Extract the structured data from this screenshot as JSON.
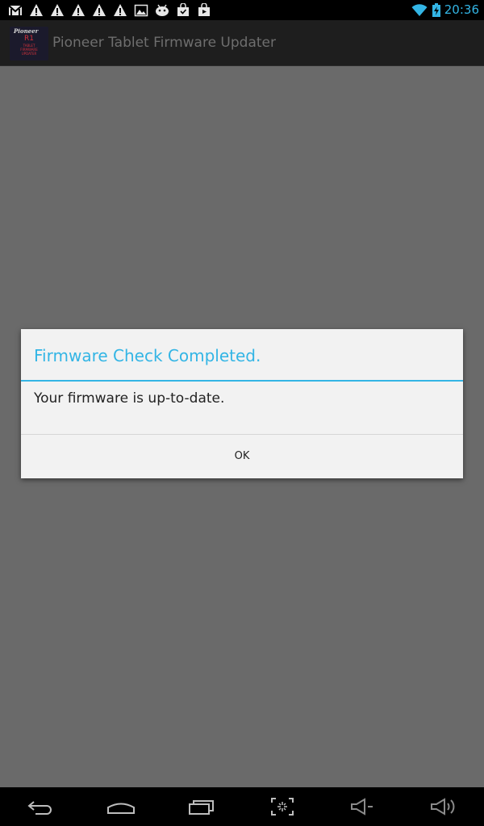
{
  "status_bar": {
    "time": "20:36",
    "accent_color": "#33b5e5",
    "notification_icons": [
      "gmail-icon",
      "warning-icon",
      "warning-icon",
      "warning-icon",
      "warning-icon",
      "warning-icon",
      "image-icon",
      "android-icon",
      "shopping-bag-icon",
      "shopping-bag-icon"
    ],
    "system_icons": [
      "wifi-icon",
      "battery-charging-icon"
    ]
  },
  "action_bar": {
    "title": "Pioneer Tablet Firmware Updater",
    "app_icon": {
      "brand": "Pioneer",
      "model": "R1",
      "caption_lines": [
        "TABLET",
        "FIRMWARE",
        "UPDATER"
      ]
    }
  },
  "dialog": {
    "title": "Firmware Check Completed.",
    "message": "Your firmware is up-to-date.",
    "ok_label": "OK"
  },
  "nav_bar": {
    "buttons": [
      "back-icon",
      "home-icon",
      "recent-apps-icon",
      "screenshot-icon",
      "volume-down-icon",
      "volume-up-icon"
    ]
  }
}
